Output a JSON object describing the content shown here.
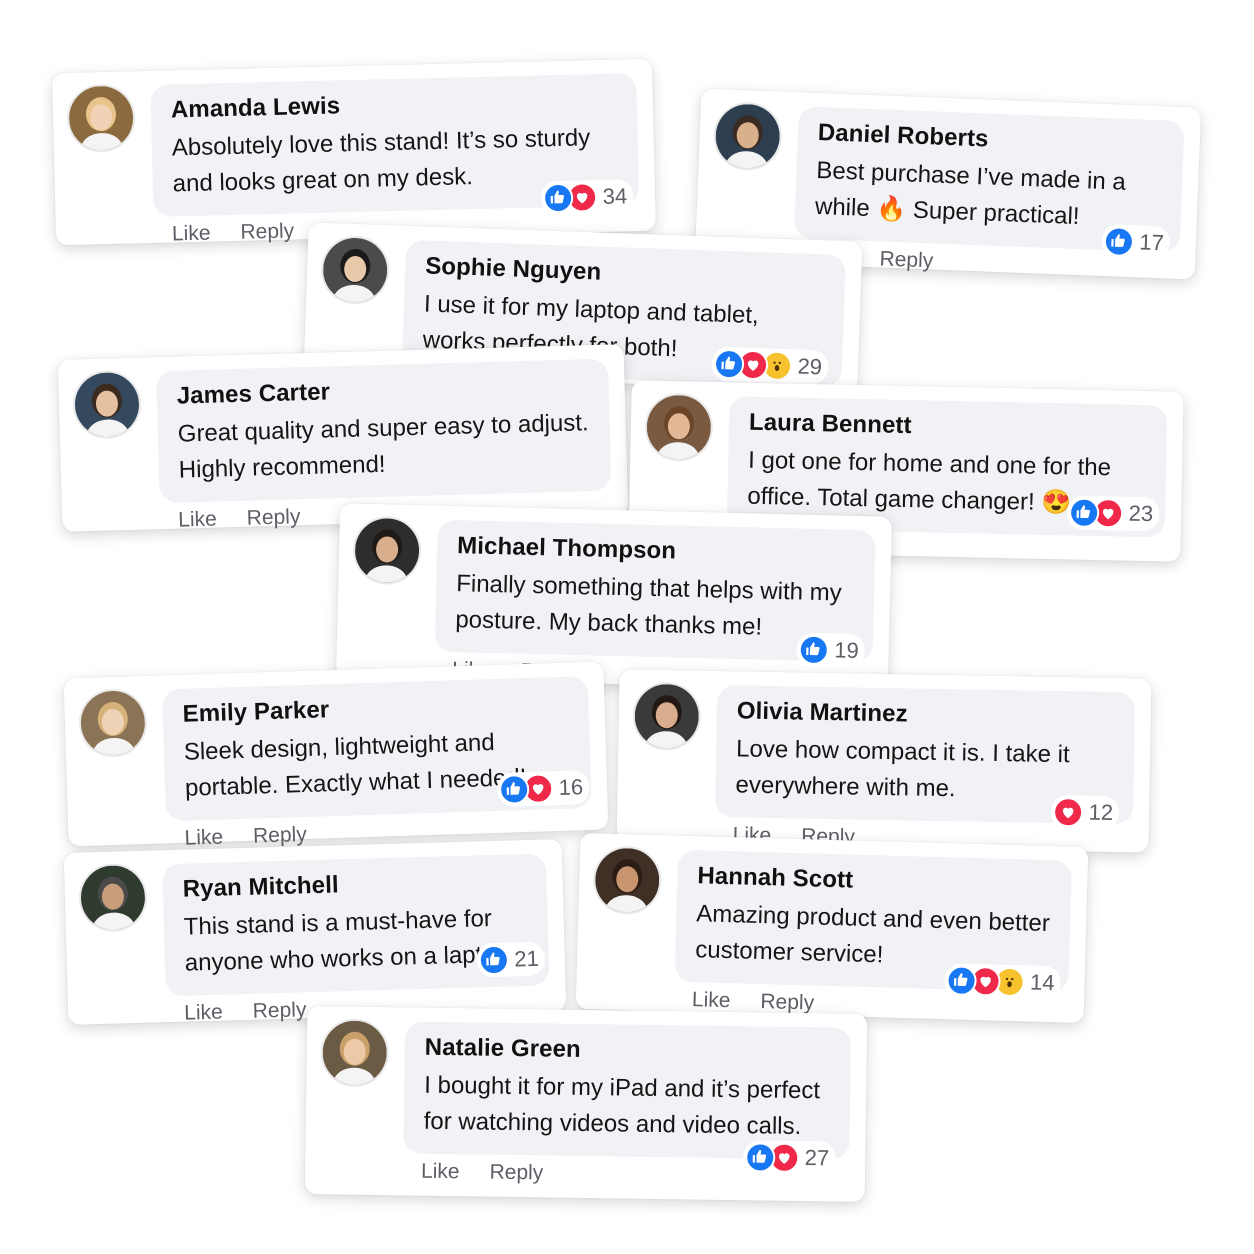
{
  "actions": {
    "like": "Like",
    "reply": "Reply"
  },
  "colors": {
    "like": "#1877f2",
    "love": "#f02849",
    "wow": "#f7c22e",
    "bubble": "#f0f2f5"
  },
  "comments": [
    {
      "name": "Amanda Lewis",
      "text": "Absolutely love this stand! It’s so sturdy and looks great on my desk.",
      "reactions": [
        "like-icon",
        "love-icon"
      ],
      "count": "34",
      "avatar": "woman-blonde-avatar"
    },
    {
      "name": "Daniel Roberts",
      "text": "Best purchase I’ve made in a while 🔥 Super practical!",
      "reactions": [
        "like-icon"
      ],
      "count": "17",
      "avatar": "man-beard-avatar"
    },
    {
      "name": "Sophie Nguyen",
      "text": "I use it for my laptop and tablet, works perfectly for both!",
      "reactions": [
        "like-icon",
        "love-icon",
        "wow-icon"
      ],
      "count": "29",
      "avatar": "woman-dark-hair-avatar"
    },
    {
      "name": "James Carter",
      "text": "Great quality and super easy to adjust. Highly recommend!",
      "reactions": [],
      "count": "",
      "avatar": "man-smiling-avatar"
    },
    {
      "name": "Laura Bennett",
      "text": "I got one for home and one for the office. Total game changer! 😍",
      "reactions": [
        "like-icon",
        "love-icon"
      ],
      "count": "23",
      "avatar": "woman-brown-hair-avatar"
    },
    {
      "name": "Michael Thompson",
      "text": "Finally something that helps with my posture. My back thanks me!",
      "reactions": [
        "like-icon"
      ],
      "count": "19",
      "avatar": "man-glasses-avatar"
    },
    {
      "name": "Emily Parker",
      "text": "Sleek design, lightweight and portable. Exactly what I needed!",
      "reactions": [
        "like-icon",
        "love-icon"
      ],
      "count": "16",
      "avatar": "woman-blonde-long-avatar"
    },
    {
      "name": "Olivia Martinez",
      "text": "Love how compact it is. I take it everywhere with me.",
      "reactions": [
        "love-icon"
      ],
      "count": "12",
      "avatar": "woman-dark-avatar"
    },
    {
      "name": "Ryan Mitchell",
      "text": "This stand is a must-have for anyone who works on a laptop.",
      "reactions": [
        "like-icon"
      ],
      "count": "21",
      "avatar": "man-cap-avatar"
    },
    {
      "name": "Hannah Scott",
      "text": "Amazing product and even better customer service!",
      "reactions": [
        "like-icon",
        "love-icon",
        "wow-icon"
      ],
      "count": "14",
      "avatar": "woman-hat-avatar"
    },
    {
      "name": "Natalie Green",
      "text": "I bought it for my iPad and it’s perfect for watching videos and video calls.",
      "reactions": [
        "like-icon",
        "love-icon"
      ],
      "count": "27",
      "avatar": "woman-sunglasses-avatar"
    }
  ]
}
